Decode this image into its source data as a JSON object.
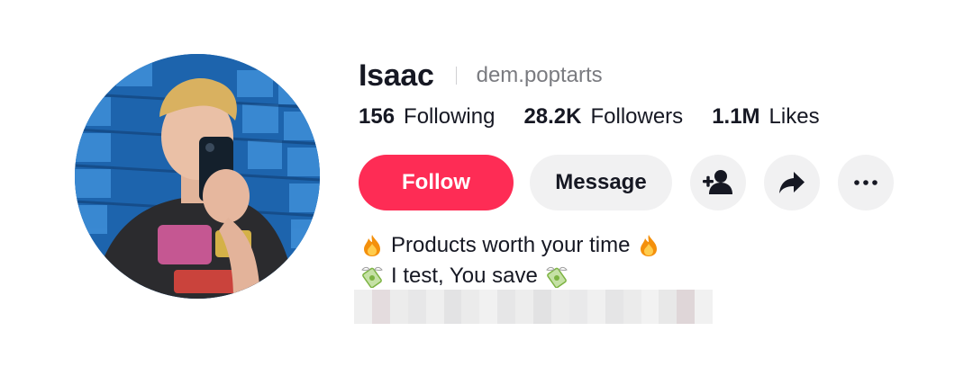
{
  "profile": {
    "display_name": "Isaac",
    "handle": "dem.poptarts",
    "avatar_alt": "Isaac"
  },
  "stats": {
    "following": {
      "value": "156",
      "label": "Following"
    },
    "followers": {
      "value": "28.2K",
      "label": "Followers"
    },
    "likes": {
      "value": "1.1M",
      "label": "Likes"
    }
  },
  "actions": {
    "follow_label": "Follow",
    "message_label": "Message",
    "icons": [
      "add-friend-icon",
      "share-icon",
      "more-icon"
    ]
  },
  "bio": {
    "line1": {
      "emoji_left": "fire-emoji",
      "text": "Products worth your time",
      "emoji_right": "fire-emoji"
    },
    "line2": {
      "emoji_left": "money-wings-emoji",
      "text": "I test, You save",
      "emoji_right": "money-wings-emoji"
    },
    "line3_redacted": true
  },
  "colors": {
    "accent": "#fe2c55",
    "text": "#161823",
    "secondary_text": "#7a7b80",
    "button_bg": "#f1f1f2"
  }
}
